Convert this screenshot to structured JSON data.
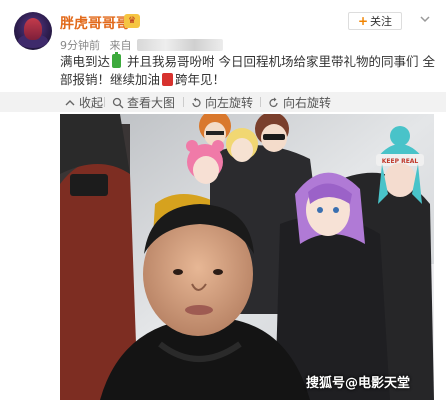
{
  "post": {
    "username": "胖虎哥哥哥",
    "badge": "vip-crown-badge",
    "time": "9分钟前",
    "source_prefix": "来自",
    "follow_label": "关注",
    "text_part1": "满电到达",
    "text_part2": "并且我易哥吩咐 今日回程机场给家里带礼物的同事们 全部报销！继续加油",
    "text_part3": "跨年见！"
  },
  "toolbar": {
    "collapse": "收起",
    "view_large": "查看大图",
    "rotate_left": "向左旋转",
    "rotate_right": "向右旋转"
  },
  "photo": {
    "watermark": "搜狐号@电影天堂",
    "sticker_text": "KEEP REAL"
  },
  "colors": {
    "username": "#e26a1b",
    "follow_plus": "#f08300",
    "toolbar_bg": "#f2f2f2"
  }
}
